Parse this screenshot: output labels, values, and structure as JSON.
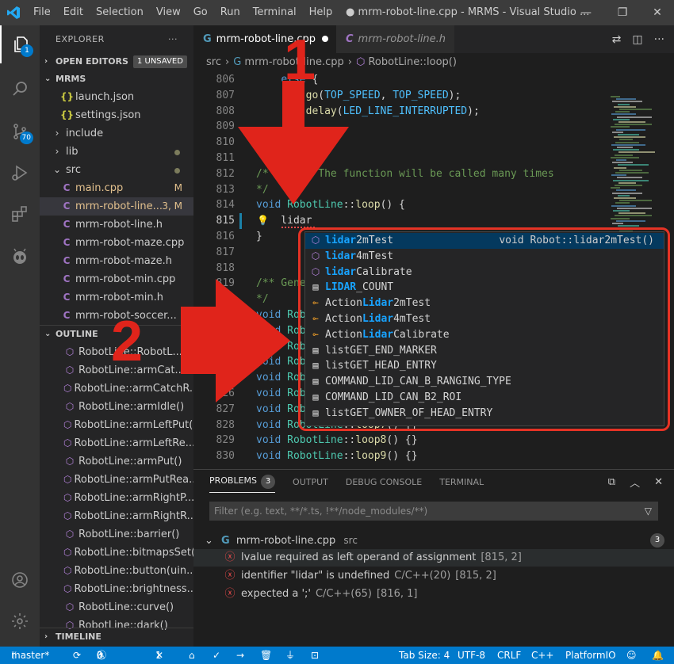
{
  "titlebar": {
    "menu": [
      "File",
      "Edit",
      "Selection",
      "View",
      "Go",
      "Run",
      "Terminal",
      "Help"
    ],
    "title": "● mrm-robot-line.cpp - MRMS - Visual Studio ..."
  },
  "activity": {
    "explorer_badge": "1",
    "scm_badge": "70"
  },
  "sidebar": {
    "header": "EXPLORER",
    "more": "···",
    "open_editors": "OPEN EDITORS",
    "unsaved": "1 UNSAVED",
    "root": "MRMS",
    "files": [
      {
        "label": "launch.json",
        "icon": "{}",
        "kind": "json"
      },
      {
        "label": "settings.json",
        "icon": "{}",
        "kind": "json"
      },
      {
        "label": "include",
        "icon": "›",
        "kind": "folder"
      },
      {
        "label": "lib",
        "icon": "›",
        "kind": "folder"
      },
      {
        "label": "src",
        "icon": "⌄",
        "kind": "folder"
      },
      {
        "label": "main.cpp",
        "icon": "C",
        "kind": "cpp",
        "deco": "M"
      },
      {
        "label": "mrm-robot-line...",
        "icon": "C",
        "kind": "cpp",
        "deco": "3, M"
      },
      {
        "label": "mrm-robot-line.h",
        "icon": "C",
        "kind": "cpp"
      },
      {
        "label": "mrm-robot-maze.cpp",
        "icon": "C",
        "kind": "cpp"
      },
      {
        "label": "mrm-robot-maze.h",
        "icon": "C",
        "kind": "cpp"
      },
      {
        "label": "mrm-robot-min.cpp",
        "icon": "C",
        "kind": "cpp"
      },
      {
        "label": "mrm-robot-min.h",
        "icon": "C",
        "kind": "cpp"
      },
      {
        "label": "mrm-robot-soccer...",
        "icon": "C",
        "kind": "cpp"
      }
    ],
    "outline_title": "OUTLINE",
    "outline": [
      "RobotLine::RobotL...",
      "RobotLine::armCat...",
      "RobotLine::armCatchR...",
      "RobotLine::armIdle()",
      "RobotLine::armLeftPut()",
      "RobotLine::armLeftRe...",
      "RobotLine::armPut()",
      "RobotLine::armPutRea...",
      "RobotLine::armRightP...",
      "RobotLine::armRightR...",
      "RobotLine::barrier()",
      "RobotLine::bitmapsSet()",
      "RobotLine::button(uin...",
      "RobotLine::brightness...",
      "RobotLine::curve()",
      "RobotLine::dark()"
    ],
    "timeline": "TIMELINE"
  },
  "editor": {
    "tab_active": "mrm-robot-line.cpp",
    "tab_inactive": "mrm-robot-line.h",
    "breadcrumb": [
      "src",
      "mrm-robot-line.cpp",
      "RobotLine::loop()"
    ],
    "lines": [
      {
        "n": "806",
        "t": "    else {"
      },
      {
        "n": "807",
        "t": "        go(TOP_SPEED, TOP_SPEED);"
      },
      {
        "n": "808",
        "t": "        delay(LED_LINE_INTERRUPTED);"
      },
      {
        "n": "809",
        "t": ""
      },
      {
        "n": "810",
        "t": "}"
      },
      {
        "n": "811",
        "t": ""
      },
      {
        "n": "812",
        "t": "/* ... t. The function will be called many times"
      },
      {
        "n": "813",
        "t": "*/"
      },
      {
        "n": "814",
        "t": "void RobotLine::loop() {"
      },
      {
        "n": "815",
        "t": "    lidar"
      },
      {
        "n": "816",
        "t": "}"
      },
      {
        "n": "817",
        "t": ""
      },
      {
        "n": "818",
        "t": ""
      },
      {
        "n": "819",
        "t": "/** Gene..."
      },
      {
        "n": "820",
        "t": "*/"
      },
      {
        "n": "821",
        "t": "void Robo..."
      },
      {
        "n": "822",
        "t": "void Robo..."
      },
      {
        "n": "823",
        "t": "void Robo..."
      },
      {
        "n": "824",
        "t": "void Robo..."
      },
      {
        "n": "825",
        "t": "void Robo..."
      },
      {
        "n": "826",
        "t": "void Robo..."
      },
      {
        "n": "827",
        "t": "void Robo..."
      },
      {
        "n": "828",
        "t": "void RobotLine::loop7() {}"
      },
      {
        "n": "829",
        "t": "void RobotLine::loop8() {}"
      },
      {
        "n": "830",
        "t": "void RobotLine::loop9() {}"
      }
    ],
    "suggest": [
      {
        "pre": "",
        "hl": "lidar",
        "post": "2mTest",
        "kind": "method",
        "detail": "void Robot::lidar2mTest()"
      },
      {
        "pre": "",
        "hl": "lidar",
        "post": "4mTest",
        "kind": "method",
        "detail": ""
      },
      {
        "pre": "",
        "hl": "lidar",
        "post": "Calibrate",
        "kind": "method",
        "detail": ""
      },
      {
        "pre": "",
        "hl": "LIDAR",
        "post": "_COUNT",
        "kind": "struct",
        "detail": ""
      },
      {
        "pre": "Action",
        "hl": "Lidar",
        "post": "2mTest",
        "kind": "cls",
        "detail": ""
      },
      {
        "pre": "Action",
        "hl": "Lidar",
        "post": "4mTest",
        "kind": "cls",
        "detail": ""
      },
      {
        "pre": "Action",
        "hl": "Lidar",
        "post": "Calibrate",
        "kind": "cls",
        "detail": ""
      },
      {
        "pre": "",
        "hl": "",
        "post": "listGET_END_MARKER",
        "kind": "struct",
        "detail": ""
      },
      {
        "pre": "",
        "hl": "",
        "post": "listGET_HEAD_ENTRY",
        "kind": "struct",
        "detail": ""
      },
      {
        "pre": "",
        "hl": "",
        "post": "COMMAND_LID_CAN_B_RANGING_TYPE",
        "kind": "struct",
        "detail": ""
      },
      {
        "pre": "",
        "hl": "",
        "post": "COMMAND_LID_CAN_B2_ROI",
        "kind": "struct",
        "detail": ""
      },
      {
        "pre": "",
        "hl": "",
        "post": "listGET_OWNER_OF_HEAD_ENTRY",
        "kind": "struct",
        "detail": ""
      }
    ]
  },
  "annotations": {
    "one": "1",
    "two": "2"
  },
  "panel": {
    "tabs": [
      "PROBLEMS",
      "OUTPUT",
      "DEBUG CONSOLE",
      "TERMINAL"
    ],
    "problems_count": "3",
    "filter_placeholder": "Filter (e.g. text, **/*.ts, !**/node_modules/**)",
    "file": "mrm-robot-line.cpp",
    "file_dir": "src",
    "file_count": "3",
    "problems": [
      {
        "msg": "lvalue required as left operand of assignment",
        "src": "",
        "pos": "[815, 2]"
      },
      {
        "msg": "identifier \"lidar\" is undefined",
        "src": "C/C++(20)",
        "pos": "[815, 2]"
      },
      {
        "msg": "expected a ';'",
        "src": "C/C++(65)",
        "pos": "[816, 1]"
      }
    ]
  },
  "statusbar": {
    "branch": "master*",
    "errors": "3",
    "warnings": "0",
    "tools": "1",
    "tab_size": "Tab Size: 4",
    "encoding": "UTF-8",
    "eol": "CRLF",
    "language": "C++",
    "platform": "PlatformIO"
  }
}
